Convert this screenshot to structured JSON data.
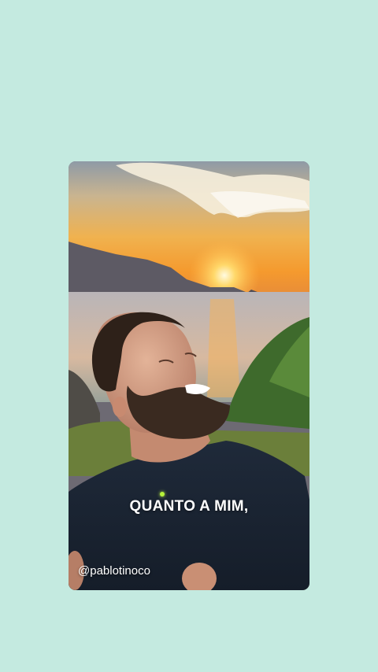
{
  "background_color": "#c4eae0",
  "story": {
    "caption": "QUANTO A MIM,",
    "username": "@pablotinoco"
  },
  "scene": {
    "description_icon": "sunset-selfie-photo"
  }
}
